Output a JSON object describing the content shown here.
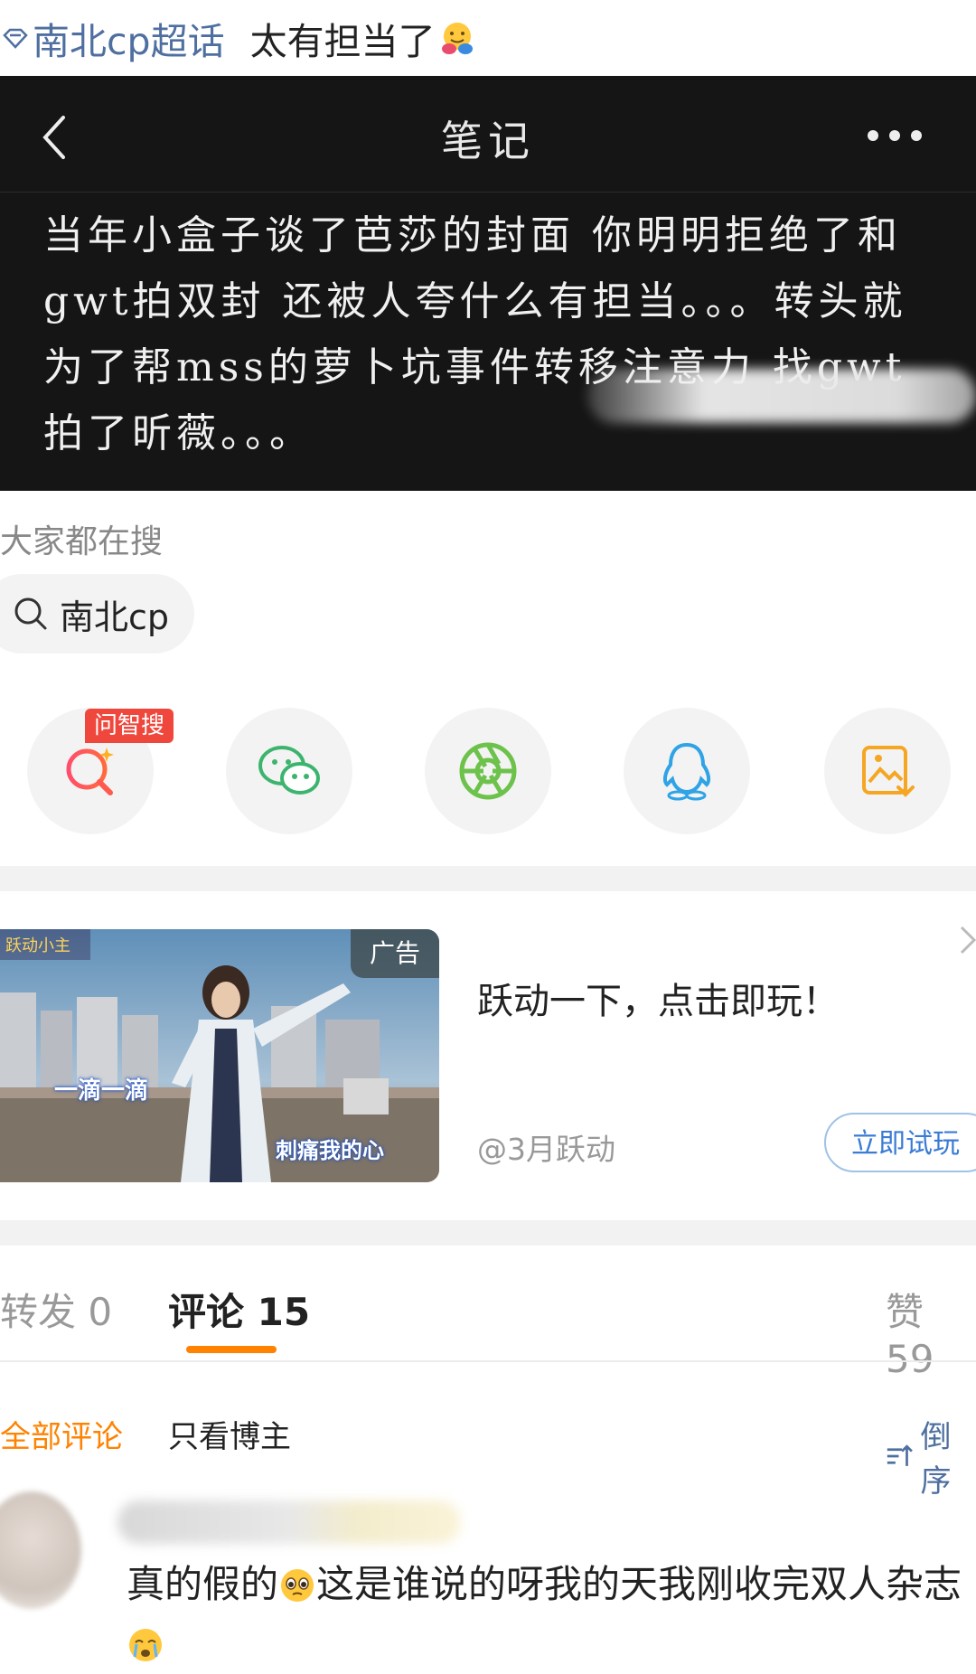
{
  "post": {
    "topic": "南北cp超话",
    "text": "太有担当了"
  },
  "note": {
    "title": "笔记",
    "body": "当年小盒子谈了芭莎的封面 你明明拒绝了和gwt拍双封 还被人夸什么有担当。。。转头就为了帮mss的萝卜坑事件转移注意力 找gwt拍了昕薇。。。"
  },
  "search": {
    "label": "大家都在搜",
    "chip": "南北cp"
  },
  "share": {
    "badge": "问智搜"
  },
  "ad": {
    "tag": "广告",
    "title": "跃动一下，点击即玩！",
    "author": "@3月跃动",
    "button": "立即试玩",
    "caption1": "一滴一滴",
    "caption2": "刺痛我的心"
  },
  "tabs": {
    "repost": "转发 0",
    "comments": "评论 15",
    "likes": "赞 59"
  },
  "filters": {
    "all": "全部评论",
    "owner": "只看博主",
    "sort": "倒序"
  },
  "comment": {
    "part1": "真的假的",
    "part2": "这是谁说的呀我的天我刚收完双人杂志"
  },
  "colors": {
    "accent": "#ff8200",
    "link": "#4f6fa0",
    "badge": "#f0473d"
  }
}
